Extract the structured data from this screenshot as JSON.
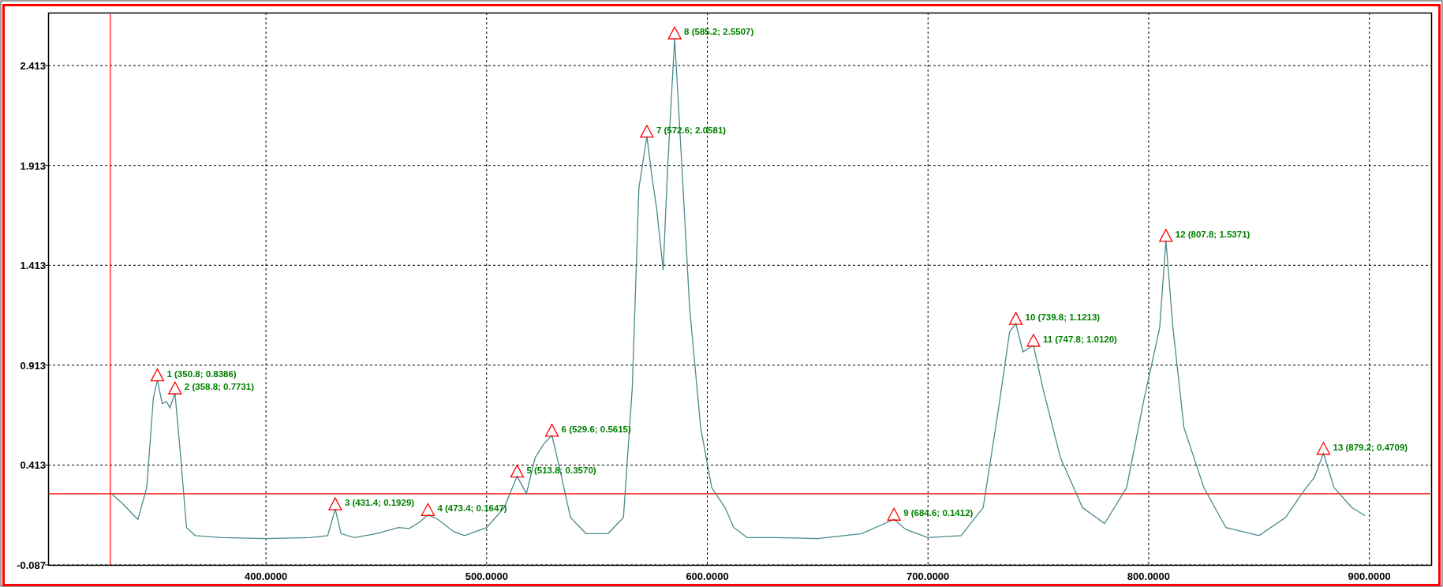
{
  "chart": {
    "chart_data": {
      "type": "line",
      "grid": true,
      "ref_lines": [
        {
          "axis": "x",
          "value": 329.5
        },
        {
          "axis": "y",
          "value": 0.269
        }
      ],
      "xlim": [
        301.3,
        928.0
      ],
      "ylim": [
        -0.087,
        2.678
      ],
      "xticks": [
        {
          "value": 400,
          "label": "400.0000"
        },
        {
          "value": 500,
          "label": "500.0000"
        },
        {
          "value": 600,
          "label": "600.0000"
        },
        {
          "value": 700,
          "label": "700.0000"
        },
        {
          "value": 800,
          "label": "800.0000"
        },
        {
          "value": 900,
          "label": "900.0000"
        }
      ],
      "yticks": [
        {
          "value": -0.087,
          "label": "-0.087"
        },
        {
          "value": 0.413,
          "label": "0.413"
        },
        {
          "value": 0.913,
          "label": "0.913"
        },
        {
          "value": 1.413,
          "label": "1.413"
        },
        {
          "value": 1.913,
          "label": "1.913"
        },
        {
          "value": 2.413,
          "label": "2.413"
        }
      ],
      "x": [
        330,
        335,
        342,
        346,
        349,
        350.8,
        353,
        355,
        356.5,
        358.8,
        361,
        364,
        368,
        380,
        400,
        420,
        428,
        431.4,
        434,
        440,
        450,
        460,
        465,
        470,
        473.4,
        478,
        485,
        490,
        500,
        508,
        513.8,
        518,
        522,
        526,
        529.6,
        533,
        538,
        545,
        555,
        562,
        566,
        569,
        572.6,
        575,
        577,
        580,
        582,
        585.2,
        588,
        592,
        597,
        602,
        608,
        612,
        618,
        630,
        650,
        670,
        684.6,
        690,
        700,
        715,
        725,
        732,
        737,
        739.8,
        743,
        747.8,
        752,
        760,
        770,
        780,
        790,
        798,
        802,
        805,
        807.8,
        811,
        816,
        825,
        835,
        850,
        862,
        870,
        875,
        879.2,
        884,
        892,
        898
      ],
      "series": [
        {
          "color": "#4a8a8c",
          "values": [
            0.27,
            0.22,
            0.14,
            0.3,
            0.75,
            0.8386,
            0.72,
            0.73,
            0.7,
            0.7731,
            0.5,
            0.1,
            0.06,
            0.05,
            0.045,
            0.05,
            0.06,
            0.1929,
            0.07,
            0.05,
            0.07,
            0.1,
            0.095,
            0.13,
            0.1647,
            0.14,
            0.08,
            0.06,
            0.1,
            0.2,
            0.357,
            0.27,
            0.45,
            0.52,
            0.5615,
            0.4,
            0.15,
            0.07,
            0.07,
            0.15,
            0.8,
            1.8,
            2.0581,
            1.85,
            1.7,
            1.39,
            1.9,
            2.5507,
            2.0,
            1.2,
            0.6,
            0.3,
            0.2,
            0.1,
            0.05,
            0.05,
            0.045,
            0.07,
            0.1412,
            0.09,
            0.05,
            0.06,
            0.2,
            0.7,
            1.08,
            1.1213,
            0.98,
            1.012,
            0.8,
            0.45,
            0.2,
            0.12,
            0.3,
            0.75,
            0.95,
            1.1,
            1.5371,
            1.1,
            0.6,
            0.3,
            0.1,
            0.06,
            0.15,
            0.28,
            0.35,
            0.4709,
            0.3,
            0.2,
            0.16
          ]
        }
      ],
      "annotations": [
        {
          "x": 350.8,
          "y": 0.8386,
          "text": "1 (350.8; 0.8386)"
        },
        {
          "x": 358.8,
          "y": 0.7731,
          "text": "2 (358.8; 0.7731)"
        },
        {
          "x": 431.4,
          "y": 0.1929,
          "text": "3 (431.4; 0.1929)"
        },
        {
          "x": 473.4,
          "y": 0.1647,
          "text": "4 (473.4; 0.1647)"
        },
        {
          "x": 513.8,
          "y": 0.357,
          "text": "5 (513.8; 0.3570)"
        },
        {
          "x": 529.6,
          "y": 0.5615,
          "text": "6 (529.6; 0.5615)"
        },
        {
          "x": 572.6,
          "y": 2.0581,
          "text": "7 (572.6; 2.0581)"
        },
        {
          "x": 585.2,
          "y": 2.5507,
          "text": "8 (585.2; 2.5507)"
        },
        {
          "x": 684.6,
          "y": 0.1412,
          "text": "9 (684.6; 0.1412)"
        },
        {
          "x": 739.8,
          "y": 1.1213,
          "text": "10 (739.8; 1.1213)"
        },
        {
          "x": 747.8,
          "y": 1.012,
          "text": "11 (747.8; 1.0120)"
        },
        {
          "x": 807.8,
          "y": 1.5371,
          "text": "12 (807.8; 1.5371)"
        },
        {
          "x": 879.2,
          "y": 0.4709,
          "text": "13 (879.2; 0.4709)"
        }
      ]
    }
  }
}
